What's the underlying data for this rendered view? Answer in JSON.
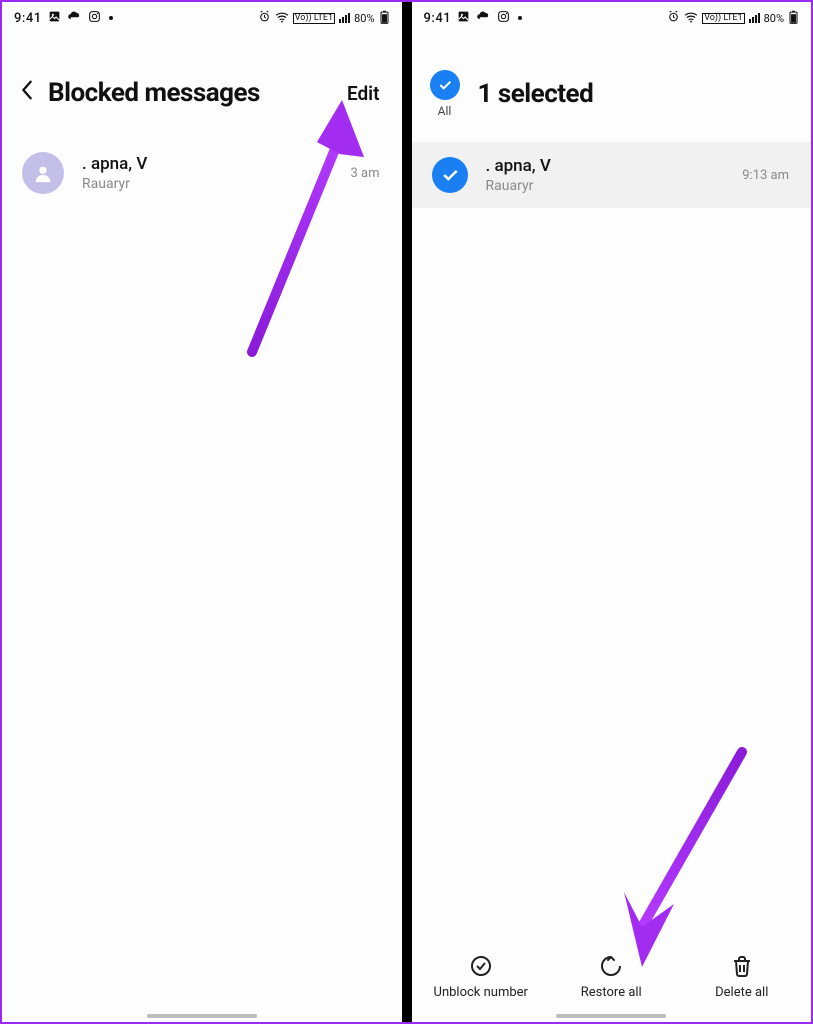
{
  "status": {
    "time": "9:41",
    "volte": "Vo)) LTE1",
    "battery": "80%"
  },
  "left": {
    "title": "Blocked messages",
    "edit": "Edit",
    "item": {
      "name": ". apna, V",
      "preview": "Rauaryr",
      "time": "3 am"
    }
  },
  "right": {
    "all": "All",
    "title": "1 selected",
    "item": {
      "name": ". apna, V",
      "preview": "Rauaryr",
      "time": "9:13 am"
    },
    "actions": {
      "unblock": "Unblock number",
      "restore": "Restore all",
      "delete": "Delete all"
    }
  }
}
